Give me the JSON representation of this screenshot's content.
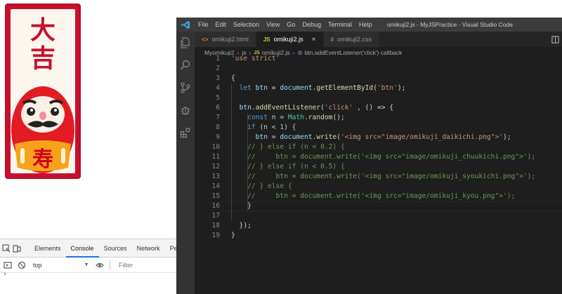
{
  "omikuji": {
    "fortune": "大吉",
    "belly_text": "寿"
  },
  "devtools": {
    "tabs": [
      "Elements",
      "Console",
      "Sources",
      "Network",
      "Perform"
    ],
    "active_tab": "Console",
    "context": "top",
    "filter_placeholder": "Filter",
    "prompt": "›"
  },
  "vscode": {
    "menu": [
      "File",
      "Edit",
      "Selection",
      "View",
      "Go",
      "Debug",
      "Terminal",
      "Help"
    ],
    "window_title": "omikuji2.js - MyJSPractice - Visual Studio Code",
    "tabs": [
      {
        "icon": "<>",
        "label": "omikuji2.html",
        "active": false
      },
      {
        "icon": "JS",
        "label": "omikuji2.js",
        "active": true,
        "close": "×"
      },
      {
        "icon": "#",
        "label": "omikuji2.css",
        "active": false
      }
    ],
    "breadcrumb": [
      "Myomikuji2",
      "js",
      "omikuji2.js",
      "btn.addEventListener('click') callback"
    ],
    "code_lines": [
      {
        "n": "1",
        "text": "'use strict'"
      },
      {
        "n": "2",
        "text": ""
      },
      {
        "n": "3",
        "text": "{"
      },
      {
        "n": "4",
        "text": "  let btn = document.getElementById('btn');"
      },
      {
        "n": "5",
        "text": ""
      },
      {
        "n": "6",
        "text": "  btn.addEventListener('click' , () => {"
      },
      {
        "n": "7",
        "text": "    const n = Math.random();"
      },
      {
        "n": "8",
        "text": "    if (n < 1) {"
      },
      {
        "n": "9",
        "text": "      btn = document.write('<img src=\"image/omikuji_daikichi.png\">');"
      },
      {
        "n": "10",
        "text": "    // } else if (n < 0.2) {"
      },
      {
        "n": "11",
        "text": "    //     btn = document.write('<img src=\"image/omikuji_chuukichi.png\">');"
      },
      {
        "n": "12",
        "text": "    // } else if (n < 0.5) {"
      },
      {
        "n": "13",
        "text": "    //     btn = document.write('<img src=\"image/omikuji_syoukichi.png\">');"
      },
      {
        "n": "14",
        "text": "    // } else {"
      },
      {
        "n": "15",
        "text": "    //     btn = document.write('<img src=\"image/omikuji_kyou.png\">');"
      },
      {
        "n": "16",
        "text": "    }"
      },
      {
        "n": "17",
        "text": ""
      },
      {
        "n": "18",
        "text": "  });"
      },
      {
        "n": "19",
        "text": "}"
      }
    ]
  },
  "colors": {
    "omikuji_red": "#c8102e",
    "vscode_bg": "#1e1e1e",
    "vscode_title": "#3c3c3c",
    "vscode_activity": "#333333",
    "accent_blue": "#1a73e8"
  },
  "icons": [
    "vscode-logo-icon",
    "explorer-icon",
    "search-icon",
    "source-control-icon",
    "debug-icon",
    "extensions-icon",
    "split-editor-icon",
    "inspect-icon",
    "device-icon",
    "clear-console-icon",
    "block-icon",
    "eye-icon"
  ]
}
